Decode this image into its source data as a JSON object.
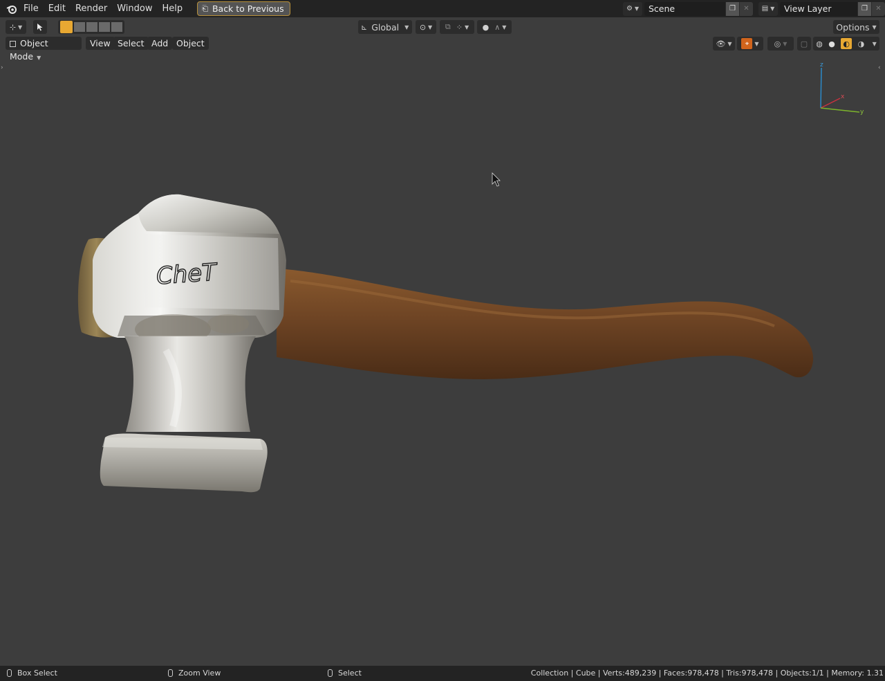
{
  "menubar": {
    "items": [
      "File",
      "Edit",
      "Render",
      "Window",
      "Help"
    ],
    "back_button": "Back to Previous",
    "scene": "Scene",
    "view_layer": "View Layer"
  },
  "toolbar": {
    "orientation": "Global",
    "options": "Options"
  },
  "header": {
    "mode": "Object Mode",
    "menus": [
      "View",
      "Select",
      "Add",
      "Object"
    ]
  },
  "gizmo": {
    "z": "z",
    "x": "x",
    "y": "y"
  },
  "scene_text": "CheT",
  "status": {
    "left": "Box Select",
    "middle": "Zoom View",
    "right": "Select",
    "info": "Collection | Cube | Verts:489,239 | Faces:978,478 | Tris:978,478 | Objects:1/1 | Memory: 1.31"
  },
  "colors": {
    "accent": "#e8a832",
    "snap_active": "#d1641c",
    "background": "#3d3d3d"
  }
}
